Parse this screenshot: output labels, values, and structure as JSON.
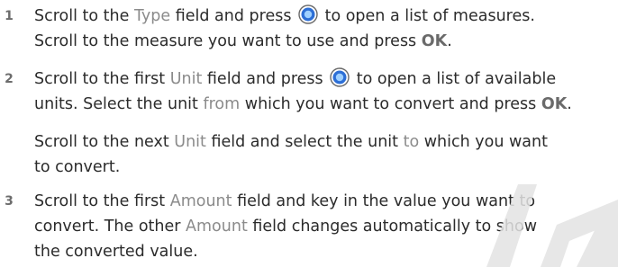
{
  "steps": [
    {
      "number": "1",
      "line1": {
        "a": "Scroll to the ",
        "field": "Type",
        "b": " field and press ",
        "c": " to open a list of measures."
      },
      "line2": {
        "a": "Scroll to the measure you want to use and press ",
        "ok": "OK",
        "b": "."
      }
    },
    {
      "number": "2",
      "line1": {
        "a": "Scroll to the first ",
        "field": "Unit",
        "b": " field and press ",
        "c": " to open a list of available"
      },
      "line2": {
        "a": "units. Select the unit ",
        "from": "from",
        "b": " which you want to convert and press ",
        "ok": "OK",
        "c": "."
      },
      "para2_line1": {
        "a": "Scroll to the next ",
        "field": "Unit",
        "b": " field and select the unit ",
        "to": "to",
        "c": " which you want"
      },
      "para2_line2": "to convert."
    },
    {
      "number": "3",
      "line1": {
        "a": "Scroll to the first ",
        "field": "Amount",
        "b": " field and key in the value you want to"
      },
      "line2": {
        "a": "convert. The other ",
        "field": "Amount",
        "b": " field changes automatically to show"
      },
      "line3": "the converted value."
    }
  ],
  "icons": {
    "nav_key": "navi-key-icon"
  },
  "colors": {
    "text": "#2b2b2b",
    "ui_term": "#8b8b8b",
    "bold_term": "#6a6a6a",
    "icon_blue": "#2d6fd6",
    "watermark": "#e3e3e3"
  }
}
